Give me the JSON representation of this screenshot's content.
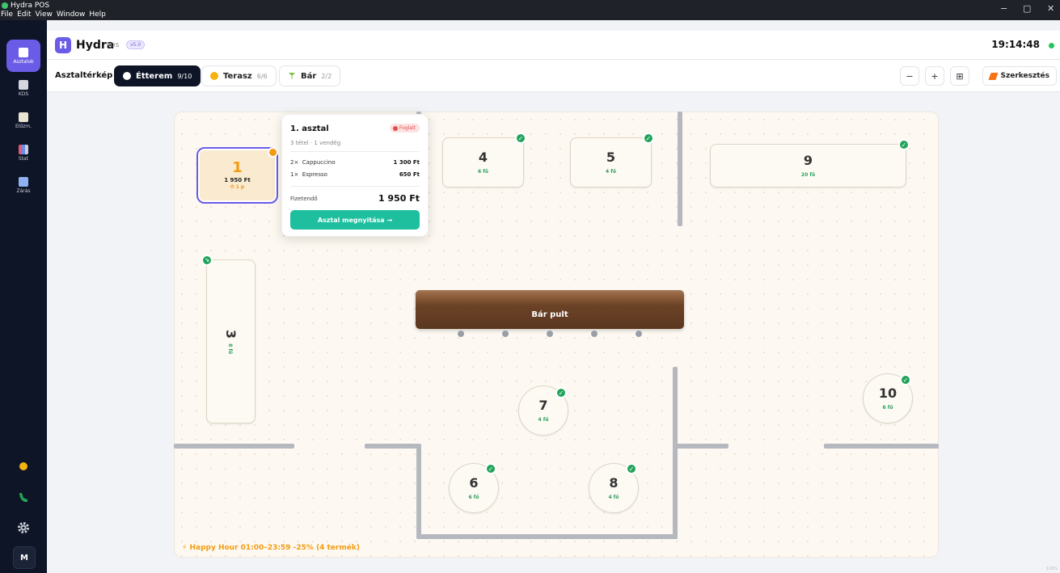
{
  "window": {
    "title": "Hydra POS",
    "menu": [
      "File",
      "Edit",
      "View",
      "Window",
      "Help"
    ],
    "controls": [
      "−",
      "▢",
      "✕"
    ]
  },
  "sidebar": {
    "items": [
      {
        "label": "Asztalok",
        "icon": "map-icon",
        "active": true
      },
      {
        "label": "KDS",
        "icon": "printer-icon",
        "active": false
      },
      {
        "label": "Előzm.",
        "icon": "clipboard-icon",
        "active": false
      },
      {
        "label": "Stat",
        "icon": "bar-chart-icon",
        "active": false
      },
      {
        "label": "Zárás",
        "icon": "calendar-icon",
        "active": false
      }
    ],
    "bottom_icons": [
      "sun-icon",
      "phone-icon",
      "gear-icon"
    ],
    "avatar_initial": "M"
  },
  "header": {
    "logo_letter": "H",
    "brand": "Hydra",
    "brand_sub": "POS",
    "version": "v5.0",
    "time": "19:14:48",
    "status_color": "#22c55e"
  },
  "toolbar": {
    "title": "Asztaltérkép",
    "tabs": [
      {
        "label": "Étterem",
        "count": "9/10",
        "icon": "plate-icon",
        "active": true
      },
      {
        "label": "Terasz",
        "count": "6/6",
        "icon": "sun-icon",
        "active": false
      },
      {
        "label": "Bár",
        "count": "2/2",
        "icon": "cocktail-icon",
        "active": false
      }
    ],
    "zoom_out": "−",
    "zoom_in": "+",
    "grid": "⊞",
    "edit_label": "Szerkesztés"
  },
  "floor": {
    "tables": [
      {
        "number": "1",
        "price": "1 950 Ft",
        "time": "⏱ 1 p",
        "status": "occupied"
      },
      {
        "number": "3",
        "seats": "8 fő",
        "status": "pending"
      },
      {
        "number": "4",
        "seats": "6 fő",
        "status": "free"
      },
      {
        "number": "5",
        "seats": "4 fő",
        "status": "free"
      },
      {
        "number": "6",
        "seats": "6 fő",
        "status": "free"
      },
      {
        "number": "7",
        "seats": "4 fő",
        "status": "free"
      },
      {
        "number": "8",
        "seats": "4 fő",
        "status": "free"
      },
      {
        "number": "9",
        "seats": "20 fő",
        "status": "free"
      },
      {
        "number": "10",
        "seats": "6 fő",
        "status": "free"
      }
    ],
    "bar_label": "Bár pult",
    "happy_hour": "Happy Hour  01:00–23:59  -25%  (4 termék)"
  },
  "popup": {
    "title": "1. asztal",
    "status": "Foglalt",
    "subtitle": "3 tétel · 1 vendég",
    "items": [
      {
        "qty": "2×",
        "name": "Cappuccino",
        "price": "1 300 Ft"
      },
      {
        "qty": "1×",
        "name": "Espresso",
        "price": "650 Ft"
      }
    ],
    "total_label": "Fizetendő",
    "total": "1 950 Ft",
    "button": "Asztal megnyitása →"
  },
  "colors": {
    "accent": "#6b5ce7",
    "free": "#22a35a",
    "occupied": "#f39b12",
    "button": "#1dbf9e",
    "sidebar": "#0e1526"
  },
  "corner_text": "116%"
}
